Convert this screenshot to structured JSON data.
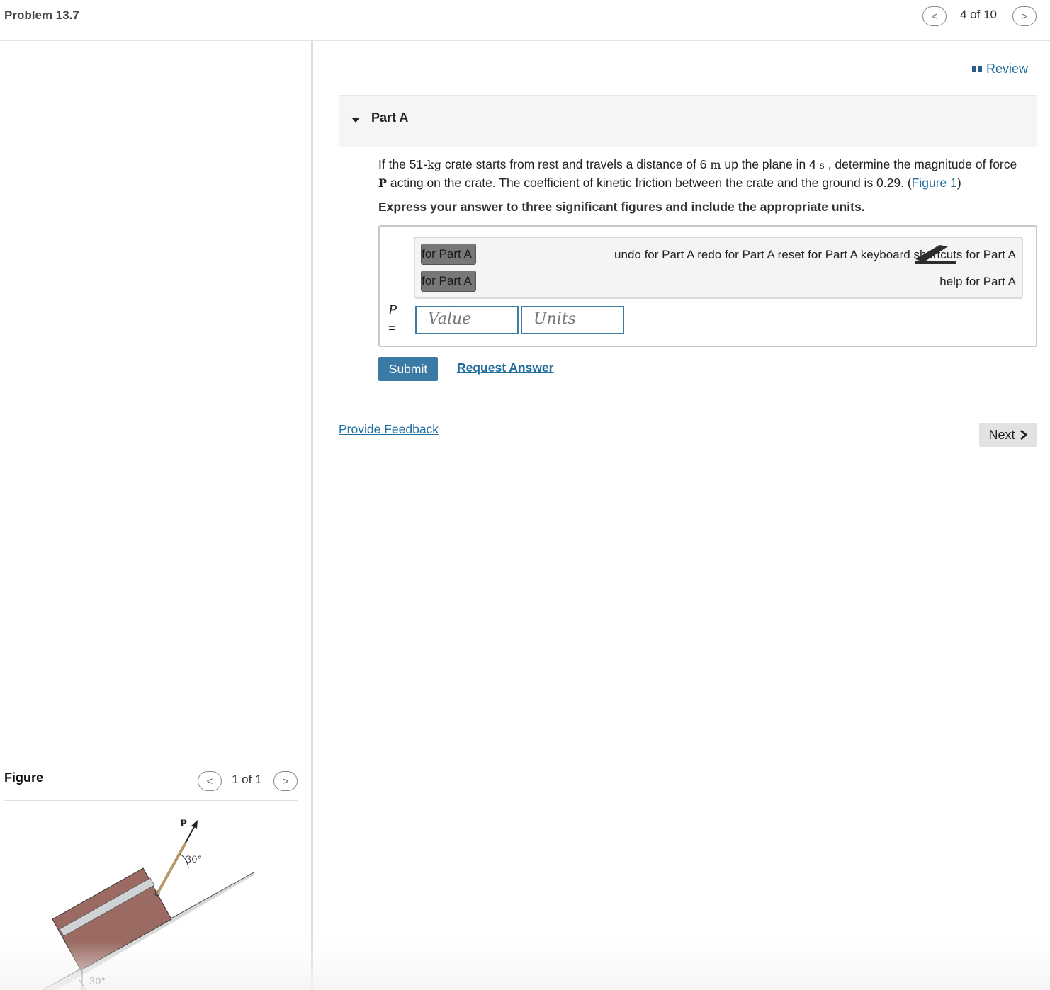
{
  "header": {
    "problem_title": "Problem 13.7",
    "pager": "4 of 10",
    "prev_label": "<",
    "next_label": ">"
  },
  "review": {
    "label": "Review"
  },
  "part": {
    "title": "Part A"
  },
  "question": {
    "t1": "If the 51-",
    "kg": "kg",
    "t2": " crate starts from rest and travels a distance of 6 ",
    "m": "m",
    "t3": " up the plane in 4 ",
    "s": "s",
    "t4": " , determine the magnitude of force",
    "P": "P",
    "t5": " acting on the crate. The coefficient of kinetic friction between the crate and the ground is 0.29. (",
    "figure_link": "Figure 1",
    "t6": ")",
    "instruction": "Express your answer to three significant figures and include the appropriate units."
  },
  "answer": {
    "tool1": "for Part A",
    "tool2": "for Part A",
    "toolbar_right": "undo for Part A  redo for Part A  reset for Part A  keyboard shortcuts for Part A",
    "help": "help for Part A",
    "p_label": "P",
    "eq_label": "=",
    "value_placeholder": "Value",
    "units_placeholder": "Units"
  },
  "actions": {
    "submit": "Submit",
    "request_answer": "Request Answer",
    "provide_feedback": "Provide Feedback",
    "next": "Next"
  },
  "figure": {
    "title": "Figure",
    "pager": "1 of 1",
    "prev_label": "<",
    "next_label": ">",
    "force_label": "P",
    "angle_rope": "30°",
    "angle_plane": "30°",
    "crate_color": "#9b6b63"
  }
}
